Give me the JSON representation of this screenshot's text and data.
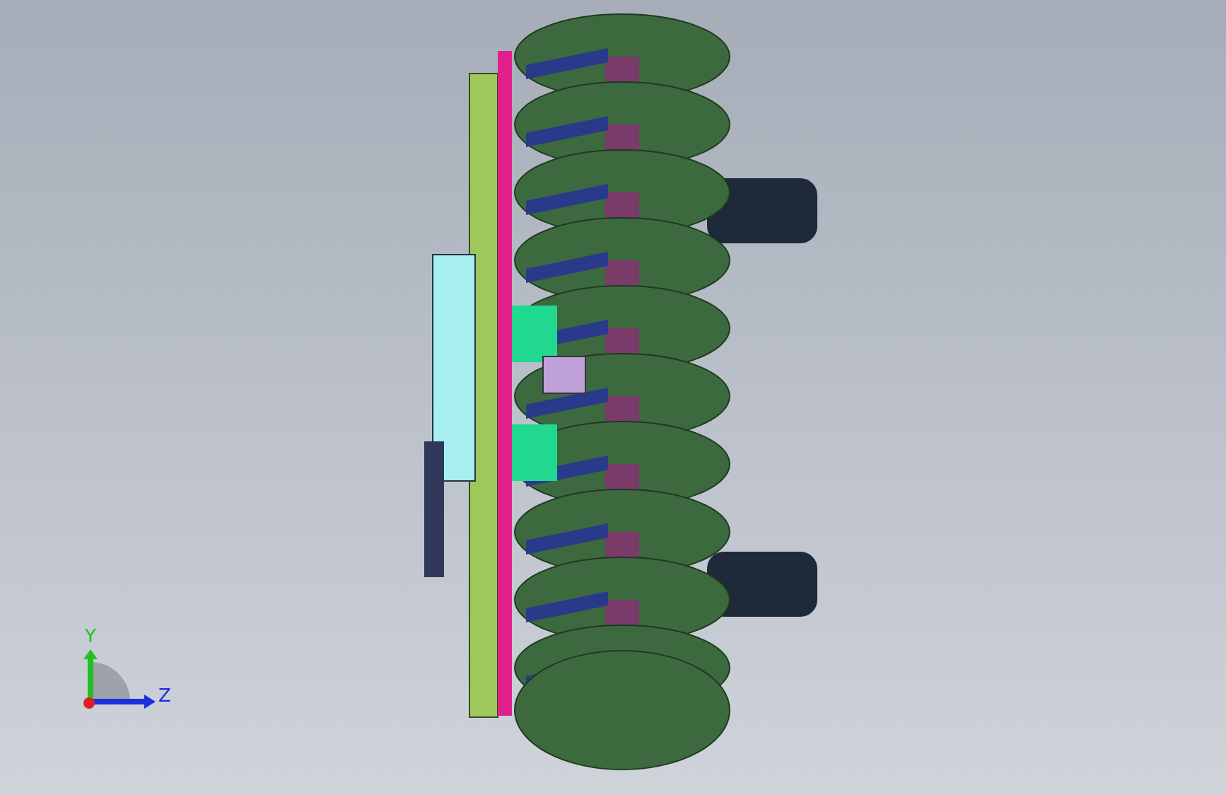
{
  "triad": {
    "axes": [
      {
        "label": "Y",
        "kind": "vertical",
        "color": "#22c022"
      },
      {
        "label": "Z",
        "kind": "horizontal",
        "color": "#1a2ee0"
      }
    ]
  }
}
